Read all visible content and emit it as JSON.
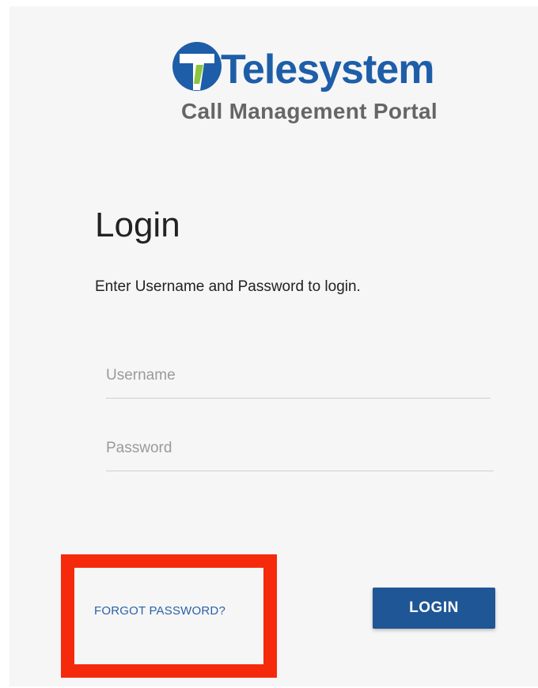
{
  "brand": {
    "name": "Telesystem",
    "trademark": "®",
    "subtitle": "Call Management Portal",
    "colors": {
      "primary": "#1e5ea8",
      "accent_green": "#8cc63f",
      "subtitle_gray": "#666666"
    },
    "logo_icon": "telesystem-logo-icon"
  },
  "login": {
    "title": "Login",
    "instructions": "Enter Username and Password to login.",
    "username": {
      "placeholder": "Username",
      "value": ""
    },
    "password": {
      "placeholder": "Password",
      "value": ""
    },
    "forgot_label": "FORGOT PASSWORD?",
    "submit_label": "LOGIN",
    "button_color": "#1e5696"
  },
  "annotation": {
    "highlight_color": "#f52a0c"
  }
}
